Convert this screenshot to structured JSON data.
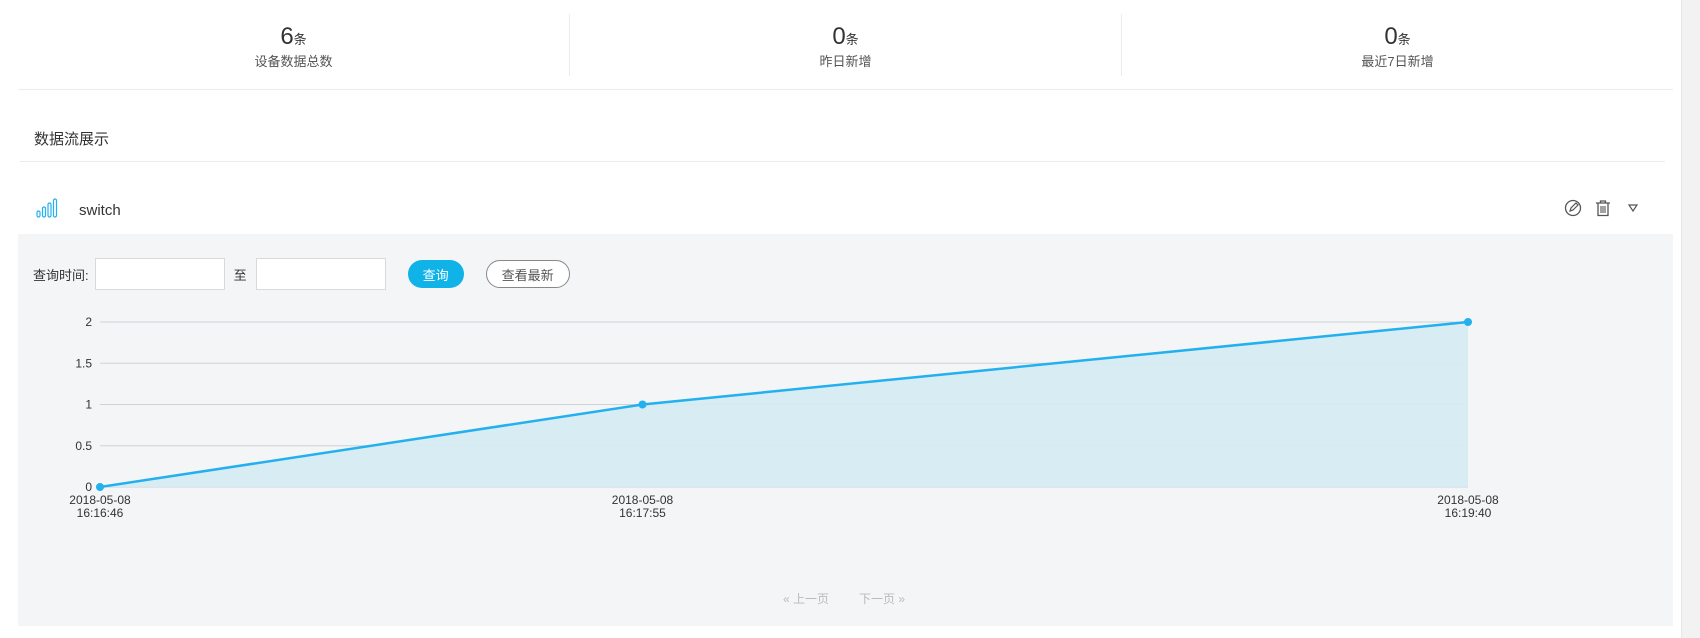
{
  "stats": [
    {
      "value": "6",
      "unit": "条",
      "label": "设备数据总数"
    },
    {
      "value": "0",
      "unit": "条",
      "label": "昨日新增"
    },
    {
      "value": "0",
      "unit": "条",
      "label": "最近7日新增"
    }
  ],
  "section": {
    "title": "数据流展示"
  },
  "stream": {
    "name": "switch",
    "icon": "bar-signal-icon",
    "actions": [
      "edit-icon",
      "trash-icon",
      "caret-down-icon"
    ]
  },
  "query": {
    "label": "查询时间:",
    "start_value": "",
    "end_value": "",
    "to_label": "至",
    "search_button": "查询",
    "latest_button": "查看最新"
  },
  "pager": {
    "prev": "« 上一页",
    "next": "下一页 »"
  },
  "colors": {
    "accent": "#0fb3e8",
    "line": "#22b0ef",
    "area": "#d5ebf3",
    "panel_bg": "#f3f5f7"
  },
  "chart_data": {
    "type": "area",
    "x": [
      "2018-05-08 16:16:46",
      "2018-05-08 16:17:55",
      "2018-05-08 16:19:40"
    ],
    "x_labels": [
      [
        "2018-05-08",
        "16:16:46"
      ],
      [
        "2018-05-08",
        "16:17:55"
      ],
      [
        "2018-05-08",
        "16:19:40"
      ]
    ],
    "series": [
      {
        "values": [
          0,
          1,
          2
        ]
      }
    ],
    "y_ticks": [
      "0",
      "0.5",
      "1",
      "1.5",
      "2"
    ],
    "ylim": [
      0,
      2
    ],
    "grid": true
  }
}
